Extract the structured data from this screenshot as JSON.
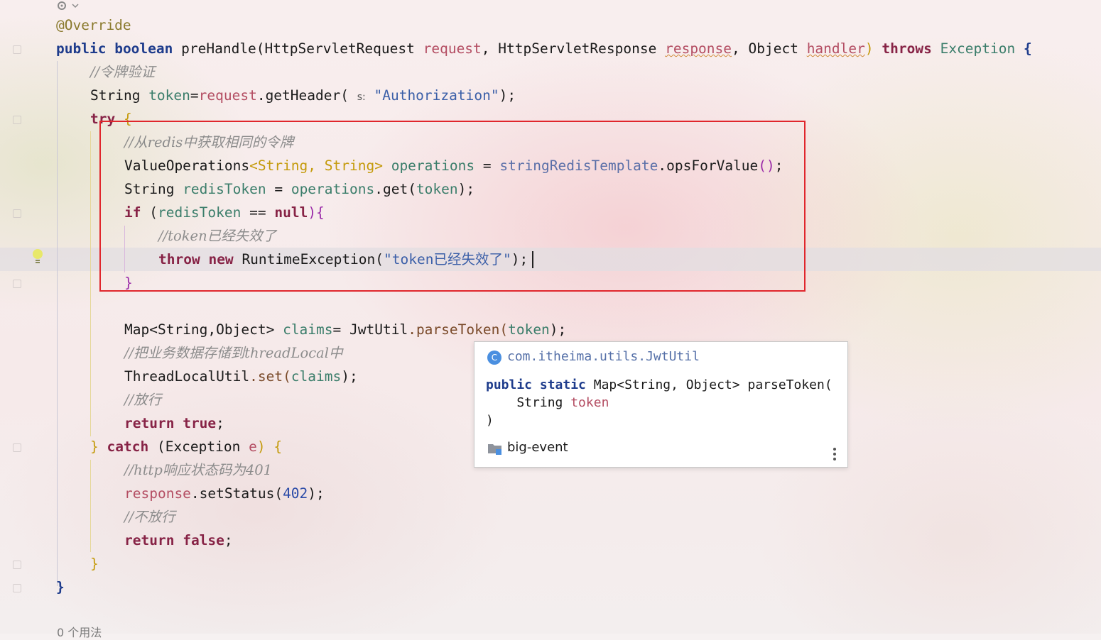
{
  "editor": {
    "gutter_hint": "s:",
    "usages_text": "0 个用法"
  },
  "code": {
    "annotation": "@Override",
    "sig": {
      "kw1": "public",
      "kw2": "boolean",
      "method": "preHandle(",
      "t1": "HttpServletRequest ",
      "p1": "request",
      "sep1": ", ",
      "t2": "HttpServletResponse ",
      "p2": "response",
      "sep2": ", Object ",
      "p3": "handler",
      "close": ")",
      "throws": "throws",
      "exc": "Exception",
      "brace": "{"
    },
    "c1": "//令牌验证",
    "l_token": {
      "type": "String ",
      "var": "token",
      "eq": "=",
      "obj": "request",
      "call": ".getHeader(",
      "str": "\"Authorization\"",
      "end": ");"
    },
    "l_try": {
      "kw": "try",
      "brace": "{"
    },
    "c2": "//从redis中获取相同的令牌",
    "l_ops": {
      "type": "ValueOperations",
      "gen": "<String, String>",
      "var": "operations",
      "eq": " = ",
      "field": "stringRedisTemplate",
      "call": ".opsForValue",
      "paren": "()",
      "end": ";"
    },
    "l_redis": {
      "type": "String ",
      "var": "redisToken",
      "mid": " = ",
      "obj": "operations",
      "call": ".get(",
      "arg": "token",
      "end": ");"
    },
    "l_if": {
      "kw": "if",
      "open": " (",
      "var": "redisToken",
      "op": " == ",
      "null": "null",
      "close": "){"
    },
    "c3": "//token已经失效了",
    "l_throw": {
      "kw1": "throw",
      "kw2": "new",
      "cls": "RuntimeException(",
      "str": "\"token已经失效了\"",
      "end": ");"
    },
    "l_ifclose": "}",
    "l_map": {
      "type": "Map<String,Object>",
      "var": "claims",
      "eq": "= ",
      "cls": "JwtUtil",
      "call": ".parseToken(",
      "arg": "token",
      "end": ");"
    },
    "c4": "//把业务数据存储到threadLocal中",
    "l_tl": {
      "cls": "ThreadLocalUtil",
      "call": ".set(",
      "arg": "claims",
      "end": ");"
    },
    "c5": "//放行",
    "l_ret_true": {
      "kw": "return",
      "val": "true",
      "end": ";"
    },
    "l_catch": {
      "brace": "}",
      "kw": "catch",
      "open": " (",
      "type": "Exception ",
      "var": "e",
      "close": ") {"
    },
    "c6": "//http响应状态码为401",
    "l_status": {
      "obj": "response",
      "call": ".setStatus(",
      "num": "402",
      "end": ");"
    },
    "c7": "//不放行",
    "l_ret_false": {
      "kw": "return",
      "val": "false",
      "end": ";"
    },
    "l_catch_close": "}",
    "l_method_close": "}"
  },
  "popup": {
    "class_icon": "C",
    "class_name": "com.itheima.utils.JwtUtil",
    "sig_public": "public",
    "sig_static": "static",
    "sig_rest": " Map<String, Object> parseToken(",
    "sig_param_type": "    String ",
    "sig_param_name": "token",
    "sig_close": ")",
    "module": "big-event"
  },
  "colors": {
    "highlight_box": "#e0262c",
    "keyword": "#1e3c8c",
    "comment": "#8c8c8c",
    "string": "#3b5fa8"
  }
}
